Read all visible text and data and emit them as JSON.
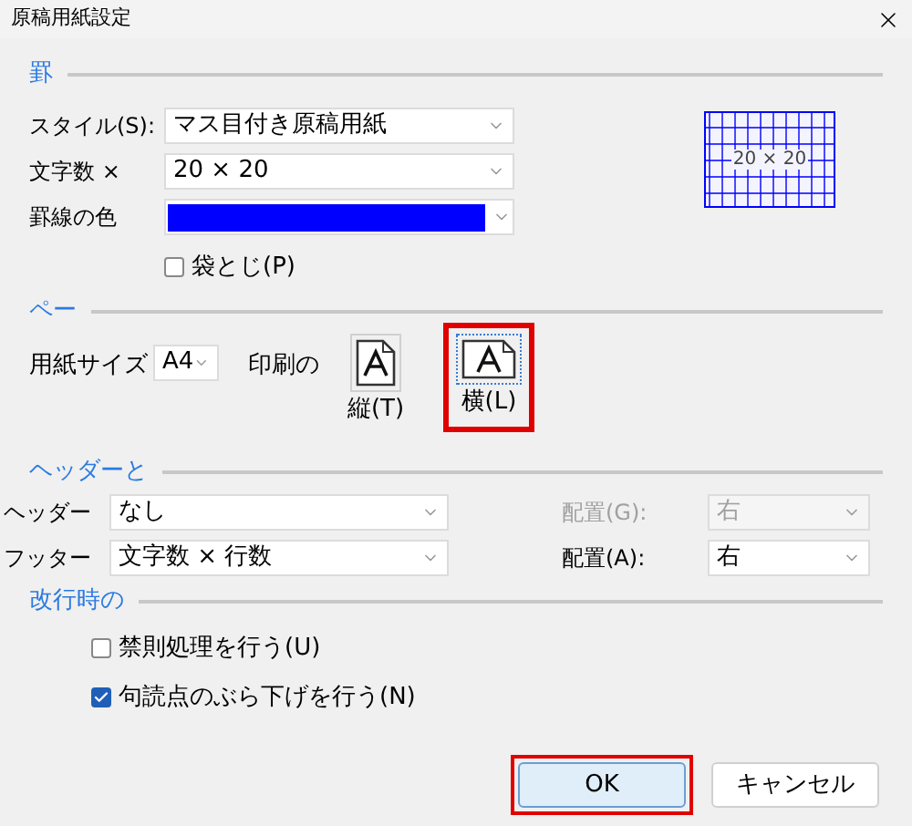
{
  "window": {
    "title": "原稿用紙設定"
  },
  "grid": {
    "heading": "罫",
    "style": {
      "label": "スタイル(S):",
      "value": "マス目付き原稿用紙"
    },
    "chars": {
      "label": "文字数 ×",
      "value": "20 × 20"
    },
    "line_color": {
      "label": "罫線の色",
      "color": "#0000ff"
    },
    "preview": {
      "text": "20 × 20"
    },
    "bound": {
      "label": "袋とじ(P)",
      "checked": false
    }
  },
  "page": {
    "heading": "ペー",
    "paper_size": {
      "label": "用紙サイズ",
      "value": "A4"
    },
    "orientation_label": "印刷の",
    "orientations": [
      {
        "label": "縦(T)",
        "kind": "portrait",
        "selected": false,
        "highlighted": false
      },
      {
        "label": "横(L)",
        "kind": "landscape",
        "selected": true,
        "highlighted": true
      }
    ]
  },
  "header_footer": {
    "heading": "ヘッダーと",
    "rows": [
      {
        "label": "ヘッダー",
        "value": "なし",
        "align_label": "配置(G):",
        "align_value": "右",
        "disabled": true
      },
      {
        "label": "フッター",
        "value": "文字数 × 行数",
        "align_label": "配置(A):",
        "align_value": "右",
        "disabled": false
      }
    ]
  },
  "line_break": {
    "heading": "改行時の",
    "options": [
      {
        "label": "禁則処理を行う(U)",
        "checked": false
      },
      {
        "label": "句読点のぶら下げを行う(N)",
        "checked": true
      }
    ]
  },
  "buttons": [
    {
      "label": "OK",
      "default": true,
      "highlighted": true
    },
    {
      "label": "キャンセル",
      "default": false,
      "highlighted": false
    }
  ]
}
